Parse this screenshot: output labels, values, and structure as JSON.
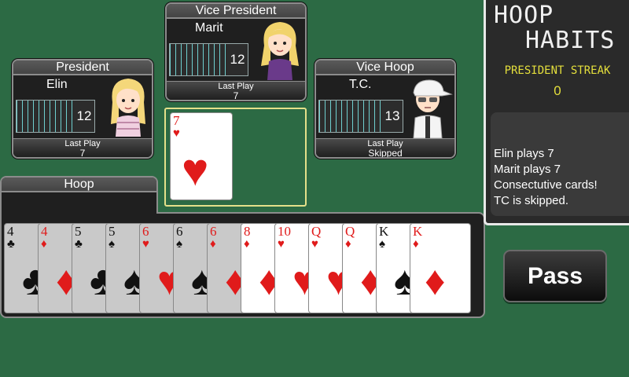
{
  "players": {
    "vice_president": {
      "title": "Vice President",
      "name": "Marit",
      "count": "12",
      "last_play_label": "Last Play",
      "last_play": "7"
    },
    "president": {
      "title": "President",
      "name": "Elin",
      "count": "12",
      "last_play_label": "Last Play",
      "last_play": "7"
    },
    "vice_hoop": {
      "title": "Vice Hoop",
      "name": "T.C.",
      "count": "13",
      "last_play_label": "Last Play",
      "last_play": "Skipped"
    }
  },
  "play_area": {
    "card": {
      "rank": "7",
      "suit": "♥",
      "color": "red"
    }
  },
  "hand": {
    "title": "Hoop",
    "cards": [
      {
        "rank": "4",
        "suit": "♣",
        "color": "black",
        "selectable": false
      },
      {
        "rank": "4",
        "suit": "♦",
        "color": "red",
        "selectable": false
      },
      {
        "rank": "5",
        "suit": "♣",
        "color": "black",
        "selectable": false
      },
      {
        "rank": "5",
        "suit": "♠",
        "color": "black",
        "selectable": false
      },
      {
        "rank": "6",
        "suit": "♥",
        "color": "red",
        "selectable": false
      },
      {
        "rank": "6",
        "suit": "♠",
        "color": "black",
        "selectable": false
      },
      {
        "rank": "6",
        "suit": "♦",
        "color": "red",
        "selectable": false
      },
      {
        "rank": "8",
        "suit": "♦",
        "color": "red",
        "selectable": true
      },
      {
        "rank": "10",
        "suit": "♥",
        "color": "red",
        "selectable": true
      },
      {
        "rank": "Q",
        "suit": "♥",
        "color": "red",
        "selectable": true
      },
      {
        "rank": "Q",
        "suit": "♦",
        "color": "red",
        "selectable": true
      },
      {
        "rank": "K",
        "suit": "♠",
        "color": "black",
        "selectable": true
      },
      {
        "rank": "K",
        "suit": "♦",
        "color": "red",
        "selectable": true
      }
    ]
  },
  "sidebar": {
    "logo_line1": "HOOP",
    "logo_line2": "HABITS",
    "streak_label": "PRESIDENT STREAK",
    "streak_value": "0",
    "log": [
      "Elin plays 7",
      "Marit plays 7",
      "Consectutive cards!",
      "TC is skipped."
    ]
  },
  "pass_button": {
    "label": "Pass"
  },
  "colors": {
    "table": "#2c6a44",
    "highlight": "#e4e08a",
    "streak": "#e4df3c",
    "red_suit": "#e01b1b"
  }
}
